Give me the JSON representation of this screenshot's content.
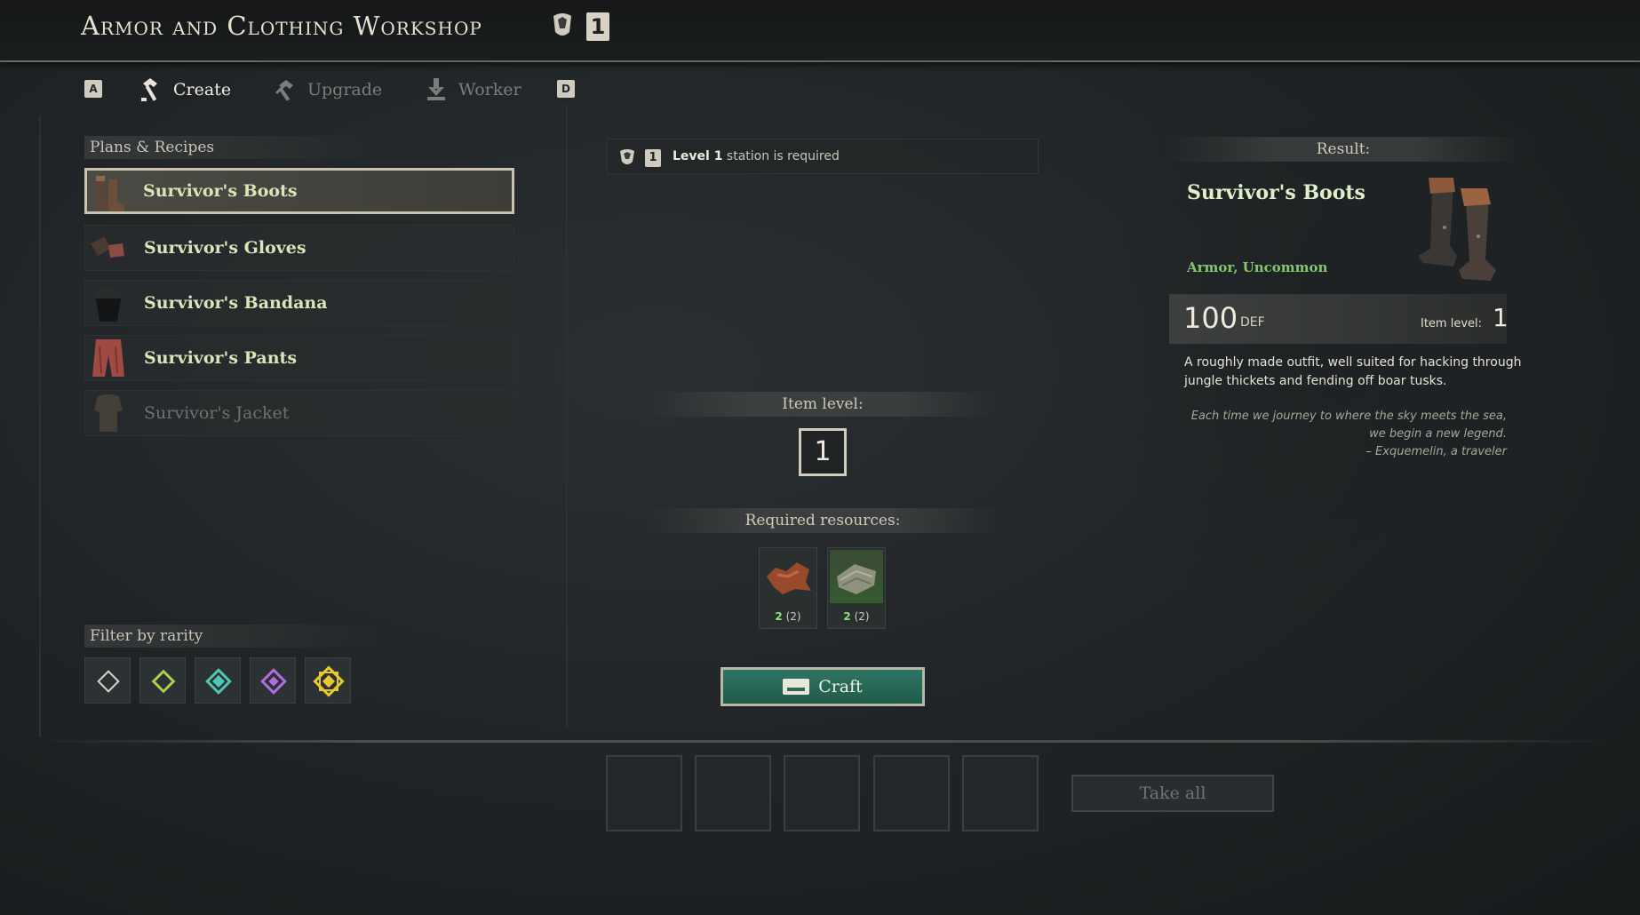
{
  "header": {
    "title": "Armor and Clothing Workshop",
    "station_level": "1"
  },
  "tabs": {
    "left_key": "A",
    "right_key": "D",
    "items": [
      {
        "label": "Create",
        "state": "active"
      },
      {
        "label": "Upgrade",
        "state": "inactive"
      },
      {
        "label": "Worker",
        "state": "inactive"
      }
    ]
  },
  "recipes": {
    "header": "Plans & Recipes",
    "items": [
      {
        "label": "Survivor's Boots",
        "state": "selected"
      },
      {
        "label": "Survivor's Gloves",
        "state": "available"
      },
      {
        "label": "Survivor's Bandana",
        "state": "available"
      },
      {
        "label": "Survivor's Pants",
        "state": "available"
      },
      {
        "label": "Survivor's Jacket",
        "state": "locked"
      }
    ]
  },
  "filter": {
    "header": "Filter by rarity",
    "rarities": [
      {
        "name": "common",
        "color": "#d8d4c8"
      },
      {
        "name": "uncommon",
        "color": "#a8d24a"
      },
      {
        "name": "rare",
        "color": "#4fc7b4"
      },
      {
        "name": "epic",
        "color": "#b36be0"
      },
      {
        "name": "legendary",
        "color": "#e6c833"
      }
    ]
  },
  "requirement": {
    "level_badge": "1",
    "level_text": "Level 1",
    "suffix": "station is required"
  },
  "crafting": {
    "item_level_label": "Item level:",
    "item_level_value": "1",
    "resources_label": "Required resources:",
    "resources": [
      {
        "name": "leather-icon",
        "have": "2",
        "need": "(2)"
      },
      {
        "name": "cloth-icon",
        "have": "2",
        "need": "(2)"
      }
    ],
    "craft_label": "Craft",
    "take_all_label": "Take all",
    "output_slots": 5
  },
  "result": {
    "header": "Result:",
    "name": "Survivor's Boots",
    "type": "Armor, Uncommon",
    "def_value": "100",
    "def_label": "DEF",
    "item_level_label": "Item level:",
    "item_level_value": "1",
    "description": "A roughly made outfit, well suited for hacking through jungle thickets and fending off boar tusks.",
    "quote_line1": "Each time we journey to where the sky meets the sea,",
    "quote_line2": "we begin a new legend.",
    "quote_line3": "– Exquemelin, a traveler"
  },
  "colors": {
    "accent_green": "#86c56f",
    "craft_button": "#2f7563",
    "name_green": "#d7e6b9"
  }
}
